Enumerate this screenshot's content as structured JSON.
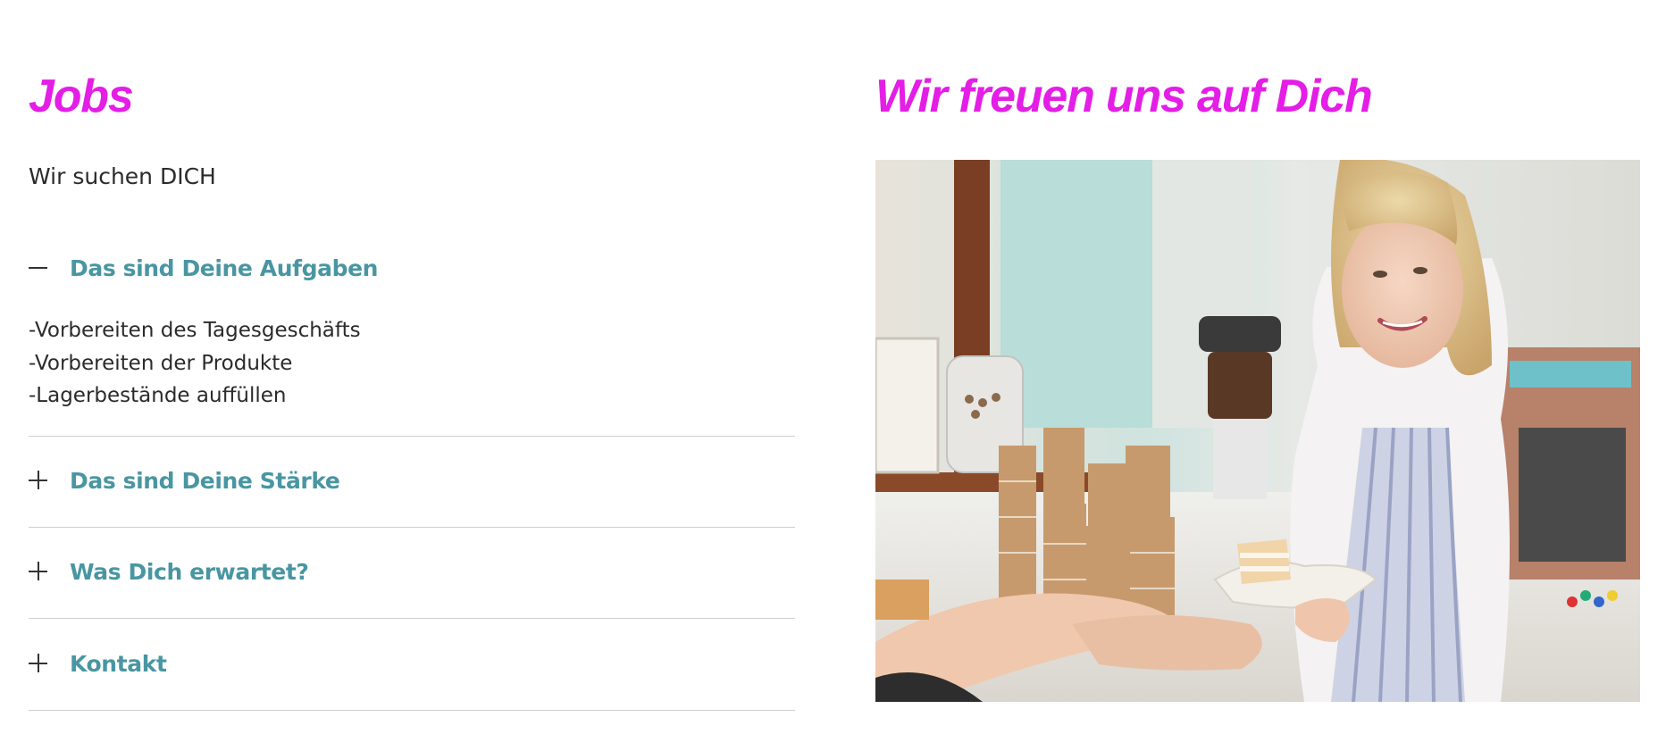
{
  "left": {
    "heading": "Jobs",
    "intro": "Wir suchen DICH",
    "accordion": [
      {
        "title": "Das sind Deine Aufgaben",
        "expanded": true,
        "icon": "minus-icon",
        "body": [
          "-Vorbereiten des Tagesgeschäfts",
          "-Vorbereiten der Produkte",
          "-Lagerbestände auffüllen"
        ]
      },
      {
        "title": "Das sind Deine Stärke",
        "expanded": false,
        "icon": "plus-icon"
      },
      {
        "title": "Was Dich erwartet?",
        "expanded": false,
        "icon": "plus-icon"
      },
      {
        "title": "Kontakt",
        "expanded": false,
        "icon": "plus-icon"
      }
    ]
  },
  "right": {
    "heading": "Wir freuen uns auf Dich"
  },
  "colors": {
    "heading": "#e41ee6",
    "accordion_title": "#4996a2",
    "text": "#2b2b2b",
    "divider": "#cfcfcf"
  }
}
